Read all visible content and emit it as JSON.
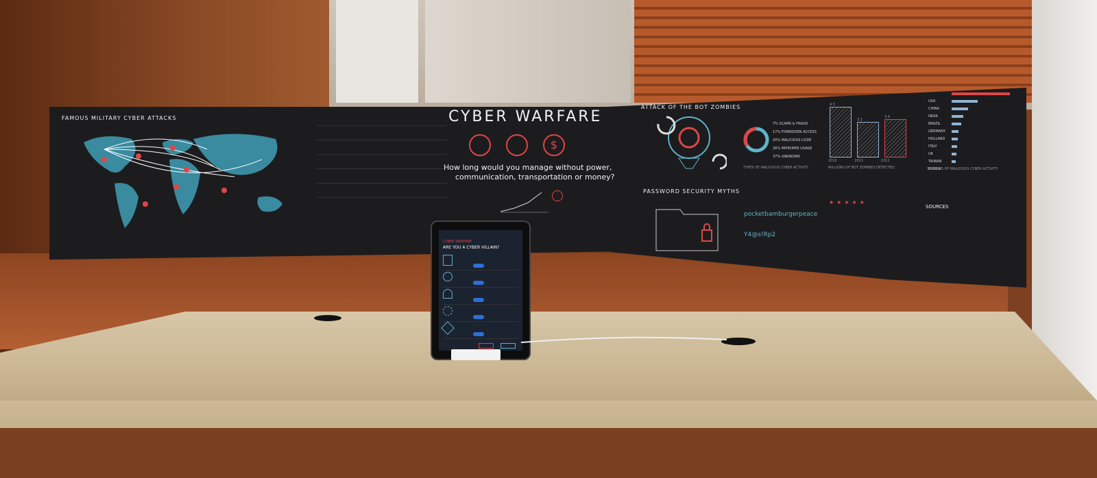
{
  "poster": {
    "left_heading": "FAMOUS MILITARY CYBER ATTACKS",
    "center_title": "CYBER WARFARE",
    "center_question_1": "How long would you manage without power,",
    "center_question_2": "communication, transportation or money?",
    "bots_heading": "ATTACK OF THE BOT ZOMBIES",
    "bots_list": [
      "7% SCAMS & FRAUD",
      "17% FORBIDDEN ACCESS",
      "20% MALICIOUS CODE",
      "26% IMPROPER USAGE",
      "37% UNKNOWN"
    ],
    "bots_caption": "TYPES OF MALICIOUS CYBER ACTIVITY",
    "bars_caption": "MILLIONS OF BOT ZOMBIES DETECTED",
    "bar_years": [
      "2010",
      "2011",
      "2012"
    ],
    "bar_values": [
      4.5,
      3.1,
      3.4
    ],
    "bar_value_labels": [
      "4.5",
      "3.1",
      "3.4"
    ],
    "countries": [
      "USA",
      "CHINA",
      "INDIA",
      "BRAZIL",
      "GERMANY",
      "HOLLAND",
      "ITALY",
      "UK",
      "TAIWAN",
      "RUSSIA"
    ],
    "country_values": [
      1.0,
      0.45,
      0.28,
      0.2,
      0.16,
      0.12,
      0.1,
      0.09,
      0.08,
      0.07
    ],
    "countries_caption": "SOURCES OF MALICIOUS CYBER ACTIVITY",
    "password_heading": "PASSWORD SECURITY MYTHS",
    "password_example_1": "pocketbamburgerpeace",
    "password_example_2": "Y4@s!Rp2",
    "sources_heading": "SOURCES"
  },
  "tablet": {
    "title_1": "CYBER WARFARE",
    "title_2": "ARE YOU A CYBER VILLAIN?"
  },
  "colors": {
    "poster_bg": "#1c1c1e",
    "accent_red": "#e04646",
    "map_teal": "#3a8aa0",
    "bar_blue": "#8fb4d6"
  }
}
